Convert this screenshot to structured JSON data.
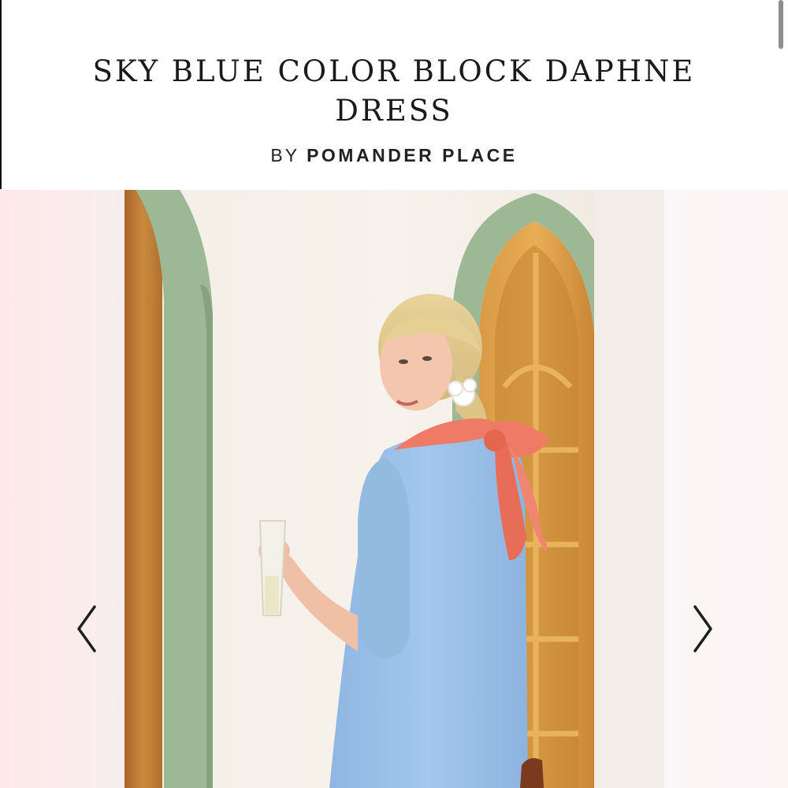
{
  "product": {
    "title": "SKY BLUE COLOR BLOCK DAPHNE DRESS",
    "vendor_prefix": "BY",
    "vendor_name": "POMANDER PLACE"
  },
  "carousel": {
    "prev_icon": "chevron-left-icon",
    "next_icon": "chevron-right-icon"
  },
  "colors": {
    "text": "#1a1a1a",
    "dress": "#9ec3ea",
    "bow": "#ef7b66",
    "arch_trim": "#9cb895",
    "door_wood": "#c98a3e"
  }
}
